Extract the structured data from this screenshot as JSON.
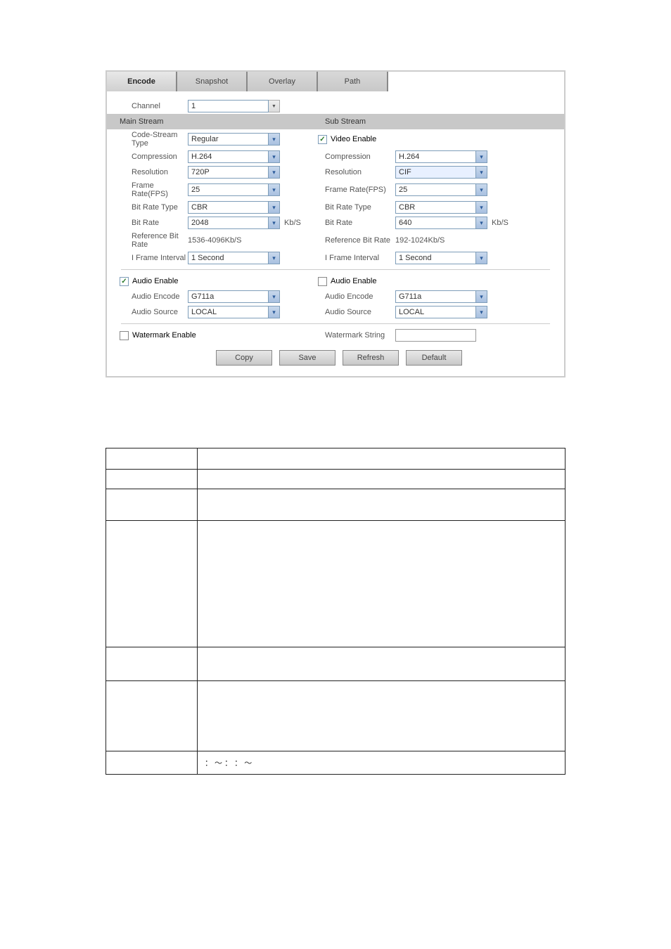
{
  "tabs": {
    "encode": "Encode",
    "snapshot": "Snapshot",
    "overlay": "Overlay",
    "path": "Path"
  },
  "channel": {
    "label": "Channel",
    "value": "1"
  },
  "main": {
    "header": "Main Stream",
    "code_stream_label": "Code-Stream Type",
    "code_stream_value": "Regular",
    "compression_label": "Compression",
    "compression_value": "H.264",
    "resolution_label": "Resolution",
    "resolution_value": "720P",
    "fps_label": "Frame Rate(FPS)",
    "fps_value": "25",
    "brt_label": "Bit Rate Type",
    "brt_value": "CBR",
    "br_label": "Bit Rate",
    "br_value": "2048",
    "br_unit": "Kb/S",
    "ref_label": "Reference Bit Rate",
    "ref_value": "1536-4096Kb/S",
    "ifi_label": "I Frame Interval",
    "ifi_value": "1 Second"
  },
  "sub": {
    "header": "Sub Stream",
    "video_enable": "Video Enable",
    "compression_label": "Compression",
    "compression_value": "H.264",
    "resolution_label": "Resolution",
    "resolution_value": "CIF",
    "fps_label": "Frame Rate(FPS)",
    "fps_value": "25",
    "brt_label": "Bit Rate Type",
    "brt_value": "CBR",
    "br_label": "Bit Rate",
    "br_value": "640",
    "br_unit": "Kb/S",
    "ref_label": "Reference Bit Rate",
    "ref_value": "192-1024Kb/S",
    "ifi_label": "I Frame Interval",
    "ifi_value": "1 Second"
  },
  "audio": {
    "enable_main": "Audio Enable",
    "enable_sub": "Audio Enable",
    "encode_label": "Audio Encode",
    "encode_value_main": "G711a",
    "encode_value_sub": "G711a",
    "source_label": "Audio Source",
    "source_value_main": "LOCAL",
    "source_value_sub": "LOCAL"
  },
  "watermark": {
    "enable": "Watermark Enable",
    "string_label": "Watermark String"
  },
  "buttons": {
    "copy": "Copy",
    "save": "Save",
    "refresh": "Refresh",
    "default": "Default"
  },
  "table": {
    "header_param": "",
    "header_func": "",
    "channel": "",
    "channel_desc": "",
    "video_enable": "",
    "video_enable_desc": "",
    "cst": "",
    "cst_desc": "",
    "compression": "",
    "compression_desc": "",
    "resolution": "",
    "resolution_desc": "",
    "fps": "",
    "fps_desc": "：    ～         ：             ：    ～"
  }
}
